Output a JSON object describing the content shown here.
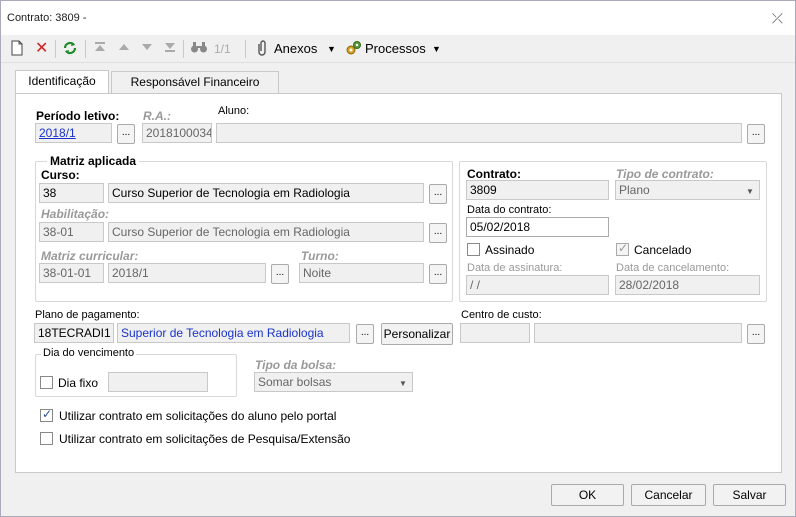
{
  "window": {
    "title": "Contrato: 3809 -",
    "close": "⤫"
  },
  "toolbar": {
    "page_indicator": "1/1",
    "anexos_label": "Anexos",
    "processos_label": "Processos"
  },
  "tabs": [
    {
      "label": "Identificação",
      "active": true
    },
    {
      "label": "Responsável Financeiro",
      "active": false
    }
  ],
  "form": {
    "periodo_label": "Período letivo:",
    "periodo_value": "2018/1",
    "ra_label": "R.A.:",
    "ra_value": "2018100034",
    "aluno_label": "Aluno:",
    "aluno_value": "",
    "matriz": {
      "legend": "Matriz aplicada",
      "curso_label": "Curso:",
      "curso_code": "38",
      "curso_name": "Curso Superior de Tecnologia em Radiologia",
      "habilitacao_label": "Habilitação:",
      "habilitacao_code": "38-01",
      "habilitacao_name": "Curso Superior de Tecnologia em Radiologia",
      "matriz_label": "Matriz curricular:",
      "matriz_code": "38-01-01",
      "matriz_period": "2018/1",
      "turno_label": "Turno:",
      "turno_value": "Noite"
    },
    "contrato": {
      "contrato_label": "Contrato:",
      "contrato_value": "3809",
      "tipo_label": "Tipo de contrato:",
      "tipo_value": "Plano",
      "data_label": "Data do contrato:",
      "data_value": "05/02/2018",
      "assinado_label": "Assinado",
      "assinado_checked": false,
      "cancelado_label": "Cancelado",
      "cancelado_checked": true,
      "data_assinatura_label": "Data de assinatura:",
      "data_assinatura_value": " /  /",
      "data_cancelamento_label": "Data de cancelamento:",
      "data_cancelamento_value": "28/02/2018"
    },
    "plano_label": "Plano de pagamento:",
    "plano_code": "18TECRADI1",
    "plano_name": "Superior de Tecnologia em Radiologia",
    "personalizar_label": "Personalizar",
    "centro_label": "Centro de custo:",
    "centro_code": "",
    "centro_name": "",
    "vencimento": {
      "legend": "Dia do vencimento",
      "dia_fixo_label": "Dia fixo",
      "dia_fixo_checked": false,
      "dia_value": ""
    },
    "bolsa_label": "Tipo da bolsa:",
    "bolsa_value": "Somar bolsas",
    "portal_label": "Utilizar contrato em solicitações do aluno pelo portal",
    "portal_checked": true,
    "pesquisa_label": "Utilizar contrato em solicitações de Pesquisa/Extensão",
    "pesquisa_checked": false,
    "ellipsis": "..."
  },
  "footer": {
    "ok_label": "OK",
    "cancelar_label": "Cancelar",
    "salvar_label": "Salvar"
  },
  "colors": {
    "link": "#1a33cc",
    "window_bg": "#f0f0f0",
    "panel_bg": "#ffffff"
  }
}
